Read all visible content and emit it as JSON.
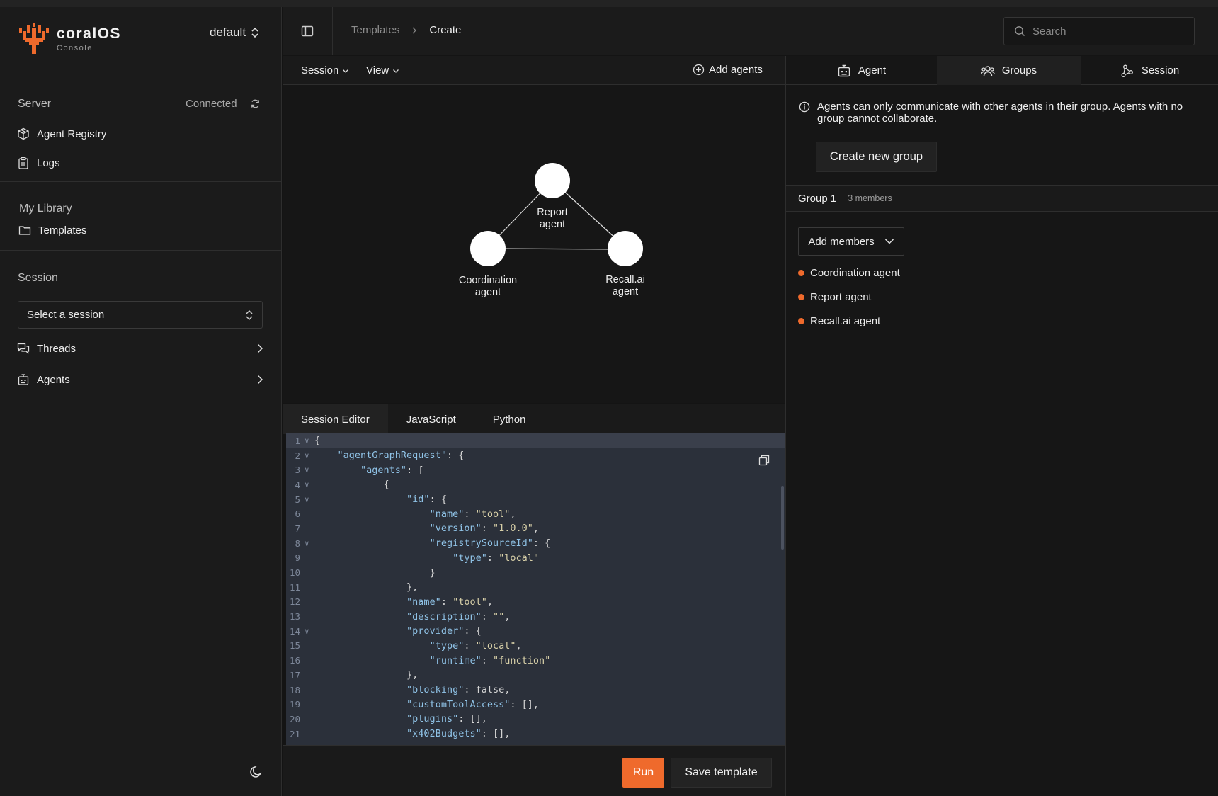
{
  "app": {
    "brand_name": "coralOS",
    "brand_sub": "Console",
    "workspace": "default",
    "accent_color": "#ef6a2c"
  },
  "sidebar": {
    "server": {
      "title": "Server",
      "status": "Connected",
      "items": [
        {
          "label": "Agent Registry",
          "icon": "package-icon"
        },
        {
          "label": "Logs",
          "icon": "clipboard-icon"
        }
      ]
    },
    "library": {
      "title": "My Library",
      "items": [
        {
          "label": "Templates",
          "icon": "folder-icon"
        }
      ]
    },
    "session": {
      "title": "Session",
      "select_placeholder": "Select a session",
      "items": [
        {
          "label": "Threads",
          "icon": "messages-icon"
        },
        {
          "label": "Agents",
          "icon": "bot-icon"
        }
      ]
    }
  },
  "header": {
    "breadcrumb": [
      "Templates",
      "Create"
    ],
    "search_placeholder": "Search"
  },
  "canvas": {
    "toolbar": {
      "session_menu": "Session",
      "view_menu": "View",
      "add_agents": "Add agents"
    },
    "nodes": [
      {
        "label_line1": "Report",
        "label_line2": "agent"
      },
      {
        "label_line1": "Coordination",
        "label_line2": "agent"
      },
      {
        "label_line1": "Recall.ai",
        "label_line2": "agent"
      }
    ]
  },
  "editor": {
    "tabs": [
      "Session Editor",
      "JavaScript",
      "Python"
    ],
    "active_tab": "Session Editor",
    "line_numbers": [
      "1",
      "2",
      "3",
      "4",
      "5",
      "6",
      "7",
      "8",
      "9",
      "10",
      "11",
      "12",
      "13",
      "14",
      "15",
      "16",
      "17",
      "18",
      "19",
      "20",
      "21"
    ],
    "lines": [
      "{",
      "    \"agentGraphRequest\": {",
      "        \"agents\": [",
      "            {",
      "                \"id\": {",
      "                    \"name\": \"tool\",",
      "                    \"version\": \"1.0.0\",",
      "                    \"registrySourceId\": {",
      "                        \"type\": \"local\"",
      "                    }",
      "                },",
      "                \"name\": \"tool\",",
      "                \"description\": \"\",",
      "                \"provider\": {",
      "                    \"type\": \"local\",",
      "                    \"runtime\": \"function\"",
      "                },",
      "                \"blocking\": false,",
      "                \"customToolAccess\": [],",
      "                \"plugins\": [],",
      "                \"x402Budgets\": [],"
    ],
    "run_label": "Run",
    "save_label": "Save template"
  },
  "right_panel": {
    "tabs": [
      {
        "label": "Agent",
        "icon": "bot-icon"
      },
      {
        "label": "Groups",
        "icon": "users-icon"
      },
      {
        "label": "Session",
        "icon": "share-icon"
      }
    ],
    "active_tab": "Groups",
    "info_text": "Agents can only communicate with other agents in their group. Agents with no group cannot collaborate.",
    "create_group_label": "Create new group",
    "group": {
      "name": "Group 1",
      "count": "3 members",
      "add_members_label": "Add members",
      "members": [
        "Coordination agent",
        "Report agent",
        "Recall.ai agent"
      ]
    }
  }
}
